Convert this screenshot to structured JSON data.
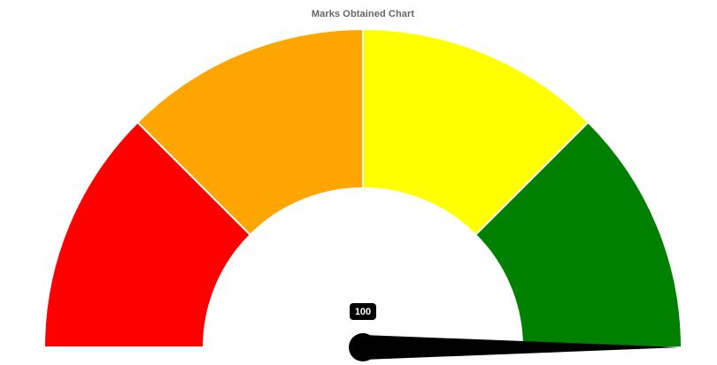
{
  "chart_data": {
    "type": "gauge",
    "title": "Marks Obtained Chart",
    "value": 100,
    "value_label": "100",
    "min": 0,
    "max": 100,
    "segments": [
      {
        "from": 0,
        "to": 25,
        "color": "#ff0000"
      },
      {
        "from": 25,
        "to": 50,
        "color": "#ffa500"
      },
      {
        "from": 50,
        "to": 75,
        "color": "#ffff00"
      },
      {
        "from": 75,
        "to": 100,
        "color": "#008000"
      }
    ],
    "segment_border_color": "#ffffff",
    "needle_color": "#000000",
    "badge_color": "#000000"
  }
}
